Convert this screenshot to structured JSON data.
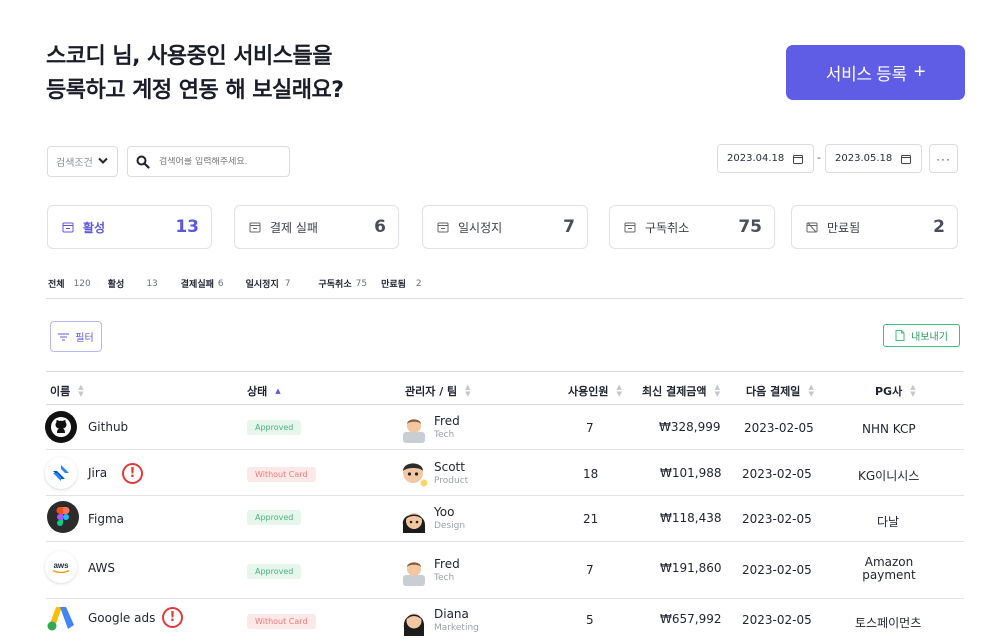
{
  "header": {
    "title_line1": "스코디 님, 사용중인 서비스들을",
    "title_line2": "등록하고 계정 연동 해 보실래요?",
    "register_label": "서비스 등록",
    "register_plus": "+"
  },
  "search": {
    "condition_label": "검색조건",
    "placeholder": "검색어를 입력해주세요."
  },
  "dates": {
    "start": "2023.04.18",
    "end": "2023.05.18",
    "separator": "-",
    "more": "···"
  },
  "stats": [
    {
      "label": "활성",
      "count": "13"
    },
    {
      "label": "결제 실패",
      "count": "6"
    },
    {
      "label": "일시정지",
      "count": "7"
    },
    {
      "label": "구독취소",
      "count": "75"
    },
    {
      "label": "만료됨",
      "count": "2"
    }
  ],
  "tabs": [
    {
      "label": "전체",
      "count": "120"
    },
    {
      "label": "활성",
      "count": "13"
    },
    {
      "label": "결제실패",
      "count": "6"
    },
    {
      "label": "일시정지",
      "count": "7"
    },
    {
      "label": "구독취소",
      "count": "75"
    },
    {
      "label": "만료됨",
      "count": "2"
    }
  ],
  "toolbar": {
    "filter_label": "필터",
    "export_label": "내보내기"
  },
  "table": {
    "columns": [
      "이름",
      "상태",
      "관리자 / 팀",
      "사용인원",
      "최신 결제금액",
      "다음 결제일",
      "PG사"
    ],
    "rows": [
      {
        "name": "Github",
        "warning": false,
        "status": "Approved",
        "manager": "Fred",
        "team": "Tech",
        "users": "7",
        "amount": "₩328,999",
        "next": "2023-02-05",
        "pg": "NHN KCP",
        "pg2": ""
      },
      {
        "name": "Jira",
        "warning": true,
        "status": "Without Card",
        "manager": "Scott",
        "team": "Product",
        "users": "18",
        "amount": "₩101,988",
        "next": "2023-02-05",
        "pg": "KG이니시스",
        "pg2": ""
      },
      {
        "name": "Figma",
        "warning": false,
        "status": "Approved",
        "manager": "Yoo",
        "team": "Design",
        "users": "21",
        "amount": "₩118,438",
        "next": "2023-02-05",
        "pg": "다날",
        "pg2": ""
      },
      {
        "name": "AWS",
        "warning": false,
        "status": "Approved",
        "manager": "Fred",
        "team": "Tech",
        "users": "7",
        "amount": "₩191,860",
        "next": "2023-02-05",
        "pg": "Amazon",
        "pg2": "payment"
      },
      {
        "name": "Google ads",
        "warning": true,
        "status": "Without Card",
        "manager": "Diana",
        "team": "Marketing",
        "users": "5",
        "amount": "₩657,992",
        "next": "2023-02-05",
        "pg": "토스페이먼츠",
        "pg2": ""
      }
    ],
    "warning_glyph": "!",
    "aws_logo_text": "aws"
  },
  "colors": {
    "accent": "#5f5ce6",
    "approved_bg": "#e6f6ec",
    "approved_fg": "#49b77a",
    "without_card_bg": "#fde8e8",
    "without_card_fg": "#ec7a7a",
    "warning": "#e23838",
    "export": "#2a9b5e"
  }
}
